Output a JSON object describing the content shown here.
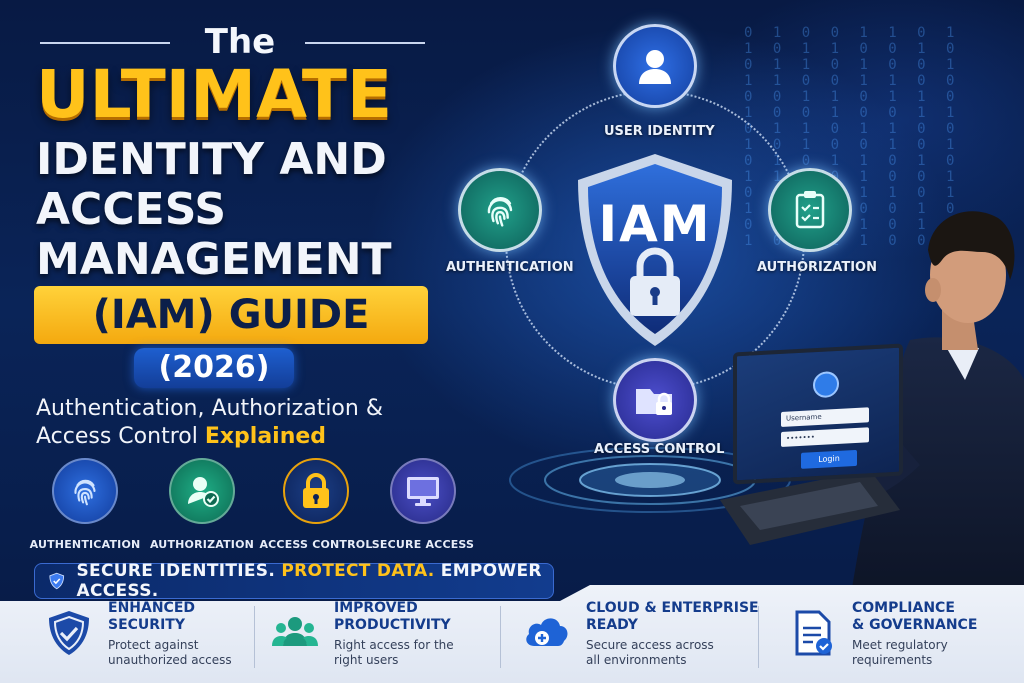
{
  "title": {
    "the": "The",
    "ultimate": "ULTIMATE",
    "line1": "IDENTITY AND",
    "line2": "ACCESS",
    "line3": "MANAGEMENT",
    "highlight": "(IAM) GUIDE",
    "year": "(2026)"
  },
  "subtitle": {
    "line1": "Authentication, Authorization &",
    "line2_prefix": "Access Control ",
    "line2_highlight": "Explained"
  },
  "icon_row": [
    {
      "label": "AUTHENTICATION",
      "icon": "fingerprint-icon",
      "color": "#1a4fb8"
    },
    {
      "label": "AUTHORIZATION",
      "icon": "user-check-icon",
      "color": "#138a6e"
    },
    {
      "label": "ACCESS CONTROL",
      "icon": "padlock-icon",
      "color": "#e8a20c"
    },
    {
      "label": "SECURE ACCESS",
      "icon": "monitor-icon",
      "color": "#3b3ea8"
    }
  ],
  "banner": {
    "part1": "SECURE IDENTITIES. ",
    "part2": "PROTECT DATA.",
    "part3": " EMPOWER ACCESS.",
    "icon": "shield-check-icon"
  },
  "diagram": {
    "center": "IAM",
    "nodes": {
      "top": {
        "label": "USER IDENTITY",
        "icon": "user-icon"
      },
      "left": {
        "label": "AUTHENTICATION",
        "icon": "fingerprint-icon"
      },
      "right": {
        "label": "AUTHORIZATION",
        "icon": "clipboard-check-icon"
      },
      "bottom": {
        "label": "ACCESS CONTROL",
        "icon": "folder-lock-icon"
      }
    }
  },
  "laptop": {
    "username_placeholder": "Username",
    "password_mask": "•••••••",
    "login_label": "Login"
  },
  "features": [
    {
      "title1": "ENHANCED",
      "title2": "SECURITY",
      "desc1": "Protect against",
      "desc2": "unauthorized access",
      "icon": "shield-check-icon"
    },
    {
      "title1": "IMPROVED",
      "title2": "PRODUCTIVITY",
      "desc1": "Right access for the",
      "desc2": "right users",
      "icon": "users-icon"
    },
    {
      "title1": "CLOUD & ENTERPRISE",
      "title2": "READY",
      "desc1": "Secure access across",
      "desc2": "all environments",
      "icon": "cloud-plus-icon"
    },
    {
      "title1": "COMPLIANCE",
      "title2": "& GOVERNANCE",
      "desc1": "Meet regulatory",
      "desc2": "requirements",
      "icon": "document-check-icon"
    }
  ],
  "colors": {
    "accent_yellow": "#ffc21a",
    "navy": "#081a44",
    "brand_blue": "#143c8c"
  }
}
